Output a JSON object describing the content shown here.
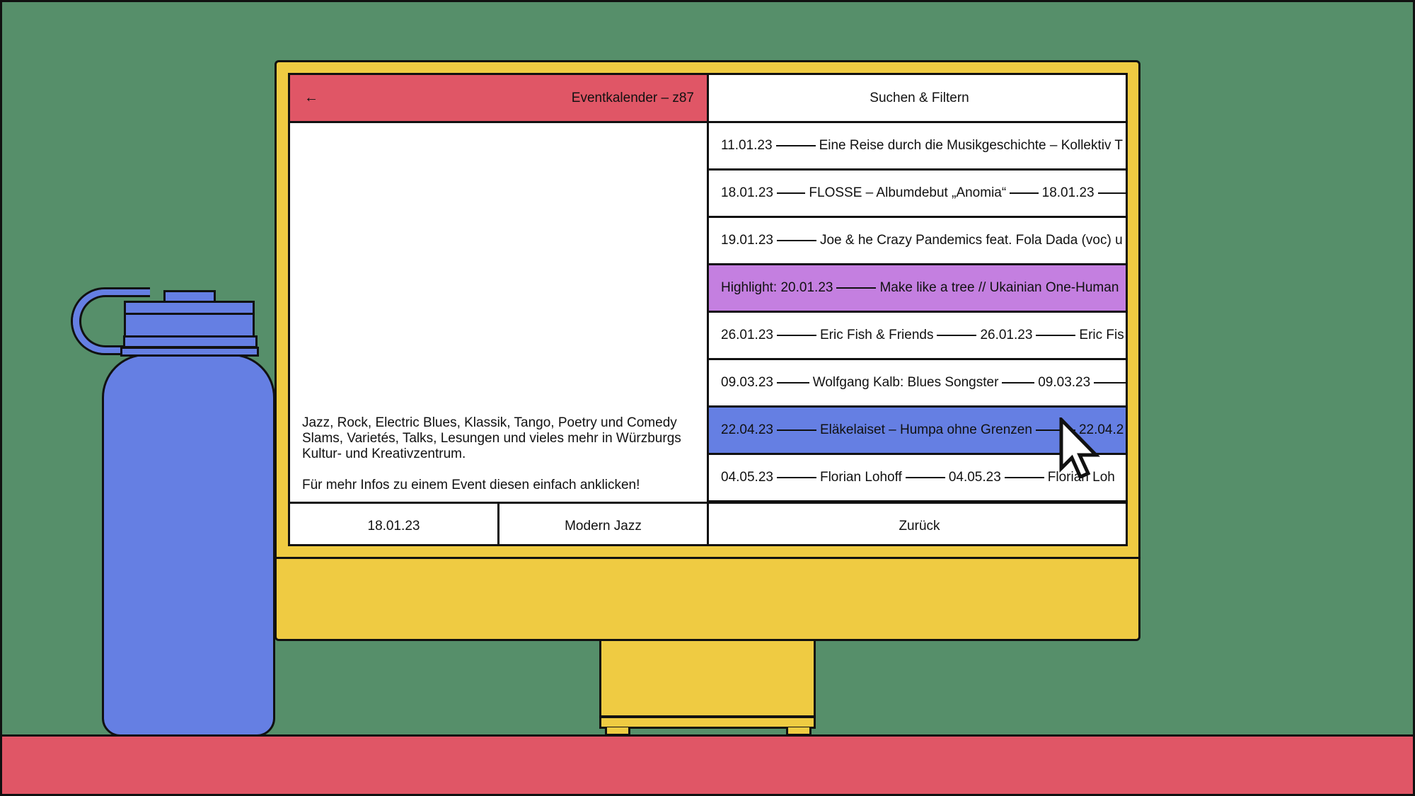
{
  "header": {
    "back_icon": "arrow-left-icon",
    "back_glyph": "←",
    "title": "Eventkalender – z87",
    "search_label": "Suchen & Filtern"
  },
  "description": {
    "text": "Jazz, Rock, Electric Blues, Klassik, Tango, Poetry und Comedy Slams, Varietés, Talks, Lesungen und vieles mehr in Würzburgs Kultur- und Kreativzentrum.",
    "hint": "Für mehr Infos zu einem Event diesen einfach anklicken!"
  },
  "events": [
    {
      "parts": [
        "11.01.23",
        "Eine Reise durch die Musikgeschichte – Kollektiv T"
      ],
      "style": "default"
    },
    {
      "parts": [
        "18.01.23",
        "FLOSSE – Albumdebut „Anomia“",
        "18.01.23",
        ""
      ],
      "style": "default"
    },
    {
      "parts": [
        "19.01.23",
        "Joe & he Crazy Pandemics feat. Fola Dada (voc) u"
      ],
      "style": "default"
    },
    {
      "parts": [
        "Highlight: 20.01.23",
        "Make like a tree // Ukainian One-Human"
      ],
      "style": "purple"
    },
    {
      "parts": [
        "26.01.23",
        "Eric Fish & Friends",
        "26.01.23",
        "Eric Fis"
      ],
      "style": "default"
    },
    {
      "parts": [
        "09.03.23",
        "Wolfgang Kalb: Blues Songster",
        "09.03.23",
        ""
      ],
      "style": "default"
    },
    {
      "parts": [
        "22.04.23",
        "Eläkelaiset – Humpa ohne Grenzen",
        "22.04.2"
      ],
      "style": "blue"
    },
    {
      "parts": [
        "04.05.23",
        "Florian Lohoff",
        "04.05.23",
        "Florian Loh"
      ],
      "style": "default"
    }
  ],
  "footer": {
    "date": "18.01.23",
    "genre": "Modern Jazz",
    "back_label": "Zurück"
  },
  "colors": {
    "background": "#568f6a",
    "desk": "#e05666",
    "monitor": "#efcb42",
    "bottle": "#657fe3",
    "header_accent": "#e05666",
    "highlight_row": "#c47fe0",
    "selected_row": "#657fe3"
  },
  "decor": {
    "cursor_icon": "mouse-pointer-icon"
  }
}
